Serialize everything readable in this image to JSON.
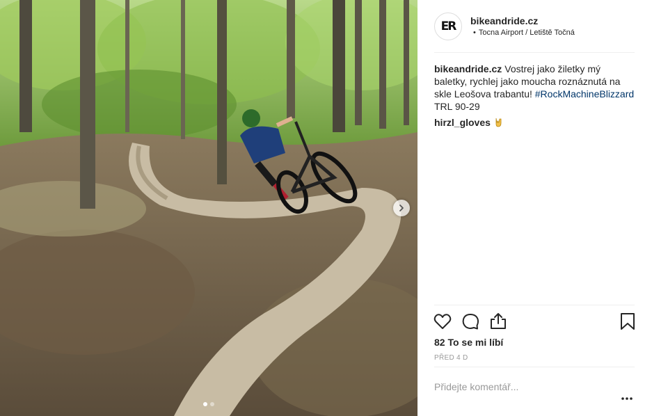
{
  "post": {
    "username": "bikeandride.cz",
    "avatar_text": "ER",
    "location": "Tocna Airport / Letiště Točná",
    "caption": {
      "user": "bikeandride.cz",
      "text": "Vostrej jako žiletky mý baletky, rychlej jako moucha roznáznutá na skle Leošova trabantu!",
      "hashtag": "#RockMachineBlizzard",
      "text_after": "TRL 90-29"
    },
    "comments": [
      {
        "user": "hirzl_gloves",
        "icon": "horns-hand-icon"
      }
    ],
    "likes_text": "82 To se mi líbí",
    "time_text": "PŘED 4 D",
    "add_comment_placeholder": "Přidejte komentář...",
    "carousel": {
      "count": 2,
      "active_index": 0
    }
  },
  "icons": {
    "like": "heart-icon",
    "comment": "comment-icon",
    "share": "share-icon",
    "save": "bookmark-icon",
    "next": "chevron-right-icon",
    "more": "more-icon"
  },
  "colors": {
    "text": "#262626",
    "muted": "#999999",
    "hashtag": "#003569",
    "divider": "#efefef"
  }
}
